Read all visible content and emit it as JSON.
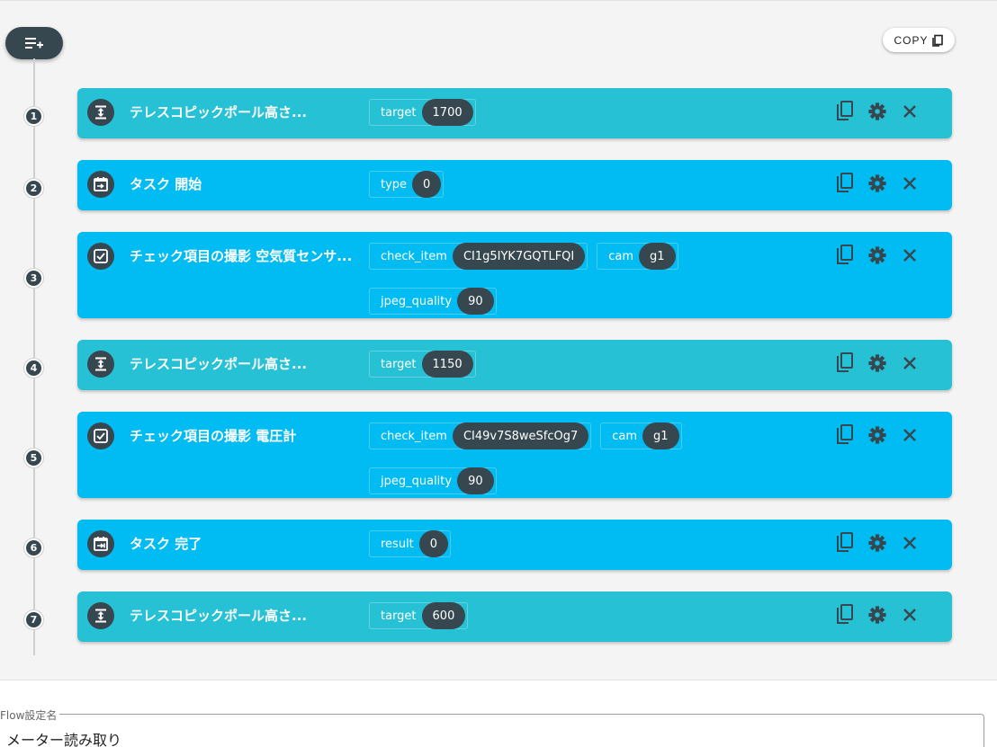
{
  "toolbar": {
    "copy_label": "COPY"
  },
  "steps": [
    {
      "num": "1",
      "title": "テレスコピックポール高さ...",
      "params": [
        {
          "key": "target",
          "value": "1700"
        }
      ]
    },
    {
      "num": "2",
      "title": "タスク 開始",
      "params": [
        {
          "key": "type",
          "value": "0"
        }
      ]
    },
    {
      "num": "3",
      "title": "チェック項目の撮影 空気質センサ...",
      "params": [
        {
          "key": "check_item",
          "value": "CI1g5IYK7GQTLFQI"
        },
        {
          "key": "cam",
          "value": "g1"
        },
        {
          "key": "jpeg_quality",
          "value": "90"
        }
      ]
    },
    {
      "num": "4",
      "title": "テレスコピックポール高さ...",
      "params": [
        {
          "key": "target",
          "value": "1150"
        }
      ]
    },
    {
      "num": "5",
      "title": "チェック項目の撮影 電圧計",
      "params": [
        {
          "key": "check_item",
          "value": "CI49v7S8weSfcOg7"
        },
        {
          "key": "cam",
          "value": "g1"
        },
        {
          "key": "jpeg_quality",
          "value": "90"
        }
      ]
    },
    {
      "num": "6",
      "title": "タスク 完了",
      "params": [
        {
          "key": "result",
          "value": "0"
        }
      ]
    },
    {
      "num": "7",
      "title": "テレスコピックポール高さ...",
      "params": [
        {
          "key": "target",
          "value": "600"
        }
      ]
    }
  ],
  "flow_name": {
    "label": "Flow設定名",
    "value": "メーター読み取り"
  },
  "colors": {
    "teal": "#26c1d4",
    "blue": "#00bcf2",
    "dark": "#37474f"
  },
  "icons": {
    "add": "playlist-add-icon",
    "copy": "copy-icon",
    "duplicate": "duplicate-icon",
    "settings": "gear-icon",
    "delete": "close-icon"
  }
}
